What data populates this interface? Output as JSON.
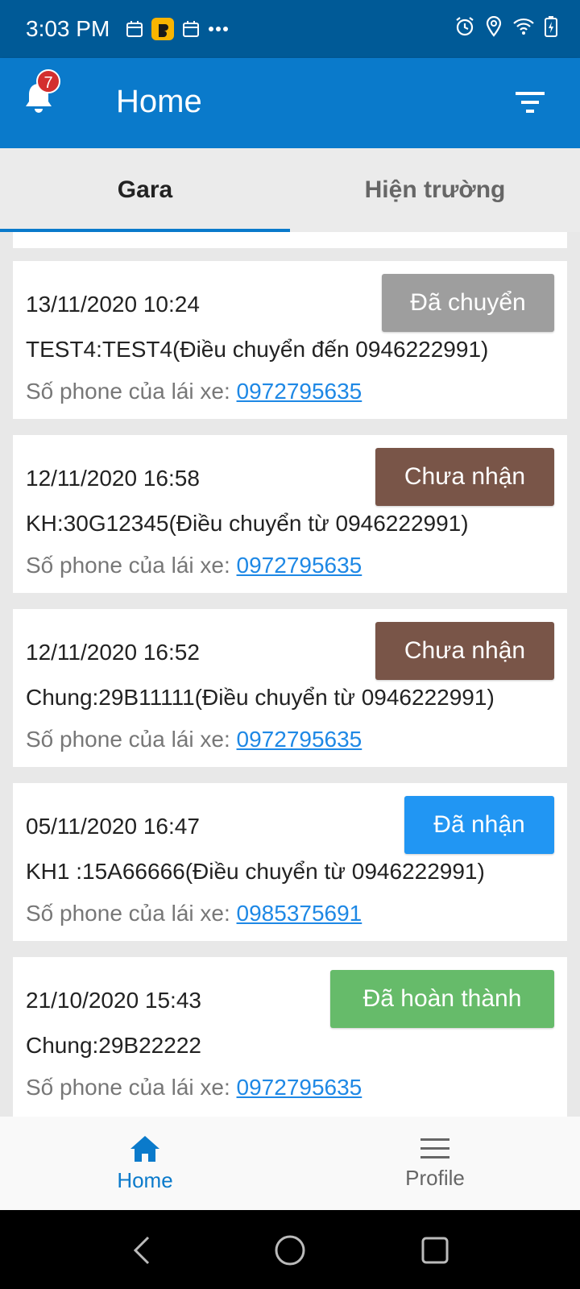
{
  "status_bar": {
    "time": "3:03 PM",
    "left_icons": [
      "calendar-icon",
      "app-notification-icon",
      "calendar-icon",
      "more-dots-icon"
    ],
    "right_icons": [
      "alarm-icon",
      "location-icon",
      "wifi-icon",
      "battery-charging-icon"
    ]
  },
  "app_bar": {
    "title": "Home",
    "notification_count": "7"
  },
  "tabs": [
    {
      "label": "Gara",
      "active": true
    },
    {
      "label": "Hiện trường",
      "active": false
    }
  ],
  "phone_label": "Số phone của lái xe:",
  "cards": [
    {
      "date": "13/11/2020 10:24",
      "title": "TEST4:TEST4(Điều chuyển đến 0946222991)",
      "phone": "0972795635",
      "status": "Đã chuyển",
      "status_color": "#9e9e9e"
    },
    {
      "date": "12/11/2020 16:58",
      "title": "KH:30G12345(Điều chuyển từ 0946222991)",
      "phone": "0972795635",
      "status": "Chưa nhận",
      "status_color": "#795548"
    },
    {
      "date": "12/11/2020 16:52",
      "title": "Chung:29B11111(Điều chuyển từ 0946222991)",
      "phone": "0972795635",
      "status": "Chưa nhận",
      "status_color": "#795548"
    },
    {
      "date": "05/11/2020 16:47",
      "title": "KH1 :15A66666(Điều chuyển từ 0946222991)",
      "phone": "0985375691",
      "status": "Đã nhận",
      "status_color": "#2196f3"
    },
    {
      "date": "21/10/2020 15:43",
      "title": "Chung:29B22222",
      "phone": "0972795635",
      "status": "Đã hoàn thành",
      "status_color": "#66bb6a"
    }
  ],
  "bottom_nav": {
    "home_label": "Home",
    "profile_label": "Profile"
  },
  "colors": {
    "primary": "#0a7acb",
    "status_bar": "#005a97",
    "link": "#1e88e5"
  }
}
